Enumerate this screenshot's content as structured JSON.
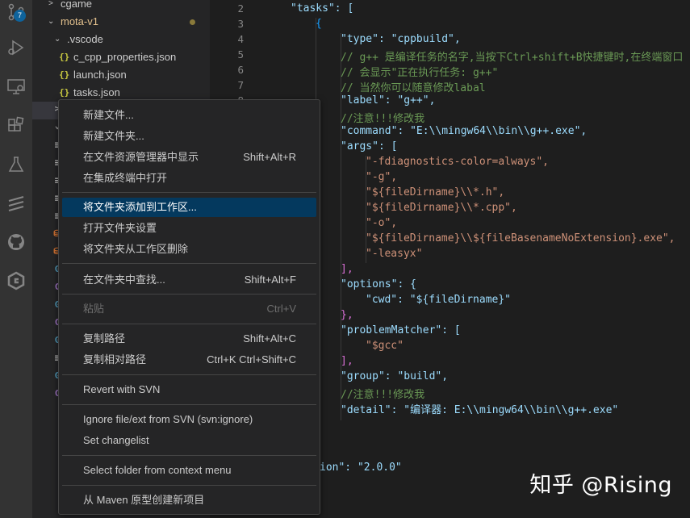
{
  "activity_bar": {
    "icons": [
      "source-control-icon",
      "run-debug-icon",
      "remote-explorer-icon",
      "extensions-icon",
      "testing-icon",
      "gitlens-icon",
      "github-icon",
      "gitkraken-icon"
    ],
    "scm_badge": "7",
    "accent": "#0e639c"
  },
  "explorer": {
    "rows": [
      {
        "label": "cgame"
      },
      {
        "label": "mota-v1"
      },
      {
        "label": ".vscode"
      },
      {
        "label": "c_cpp_properties.json",
        "icon": "{}"
      },
      {
        "label": "launch.json",
        "icon": "{}"
      },
      {
        "label": "tasks.json",
        "icon": "{}"
      }
    ],
    "peek_glyphs": [
      ">",
      "⌄",
      "≡",
      "≡",
      "≡",
      "≡",
      "≡",
      "⛁",
      "⛁",
      "G",
      "C",
      "G",
      "C",
      "G",
      "≡",
      "G",
      "C"
    ]
  },
  "editor": {
    "line_numbers": [
      "2",
      "3",
      "4",
      "5",
      "6",
      "7",
      "8"
    ],
    "lines": [
      {
        "t": "\"tasks\": ["
      },
      {
        "t": "{"
      },
      {
        "t": "\"type\": \"cppbuild\","
      },
      {
        "t": "// g++ 是编译任务的名字,当按下Ctrl+shift+B快捷键时,在终端窗口"
      },
      {
        "t": "// 会显示\"正在执行任务: g++\""
      },
      {
        "t": "// 当然你可以随意修改labal"
      },
      {
        "t": "\"label\": \"g++\","
      },
      {
        "t": "//注意!!!修改我"
      },
      {
        "t": "\"command\": \"E:\\\\mingw64\\\\bin\\\\g++.exe\","
      },
      {
        "t": "\"args\": ["
      },
      {
        "t": "\"-fdiagnostics-color=always\","
      },
      {
        "t": "\"-g\","
      },
      {
        "t": "\"${fileDirname}\\\\*.h\","
      },
      {
        "t": "\"${fileDirname}\\\\*.cpp\","
      },
      {
        "t": "\"-o\","
      },
      {
        "t": "\"${fileDirname}\\\\${fileBasenameNoExtension}.exe\","
      },
      {
        "t": "\"-leasyx\""
      },
      {
        "t": "],"
      },
      {
        "t": "\"options\": {"
      },
      {
        "t": "\"cwd\": \"${fileDirname}\""
      },
      {
        "t": "},"
      },
      {
        "t": "\"problemMatcher\": ["
      },
      {
        "t": "\"$gcc\""
      },
      {
        "t": "],"
      },
      {
        "t": "\"group\": \"build\","
      },
      {
        "t": "//注意!!!修改我"
      },
      {
        "t": "\"detail\": \"编译器: E:\\\\mingw64\\\\bin\\\\g++.exe\""
      },
      {
        "t": "ion\": \"2.0.0\""
      }
    ]
  },
  "context_menu": {
    "items": [
      {
        "label": "新建文件...",
        "shortcut": ""
      },
      {
        "label": "新建文件夹...",
        "shortcut": ""
      },
      {
        "label": "在文件资源管理器中显示",
        "shortcut": "Shift+Alt+R"
      },
      {
        "label": "在集成终端中打开",
        "shortcut": ""
      },
      {
        "label": "将文件夹添加到工作区...",
        "shortcut": ""
      },
      {
        "label": "打开文件夹设置",
        "shortcut": ""
      },
      {
        "label": "将文件夹从工作区删除",
        "shortcut": ""
      },
      {
        "label": "在文件夹中查找...",
        "shortcut": "Shift+Alt+F"
      },
      {
        "label": "粘贴",
        "shortcut": "Ctrl+V"
      },
      {
        "label": "复制路径",
        "shortcut": "Shift+Alt+C"
      },
      {
        "label": "复制相对路径",
        "shortcut": "Ctrl+K Ctrl+Shift+C"
      },
      {
        "label": "Revert with SVN",
        "shortcut": ""
      },
      {
        "label": "Ignore file/ext from SVN (svn:ignore)",
        "shortcut": ""
      },
      {
        "label": "Set changelist",
        "shortcut": ""
      },
      {
        "label": "Select folder from context menu",
        "shortcut": ""
      },
      {
        "label": "从 Maven 原型创建新项目",
        "shortcut": ""
      }
    ],
    "highlight_color": "#04395e"
  },
  "watermark": "知乎 @Rising"
}
